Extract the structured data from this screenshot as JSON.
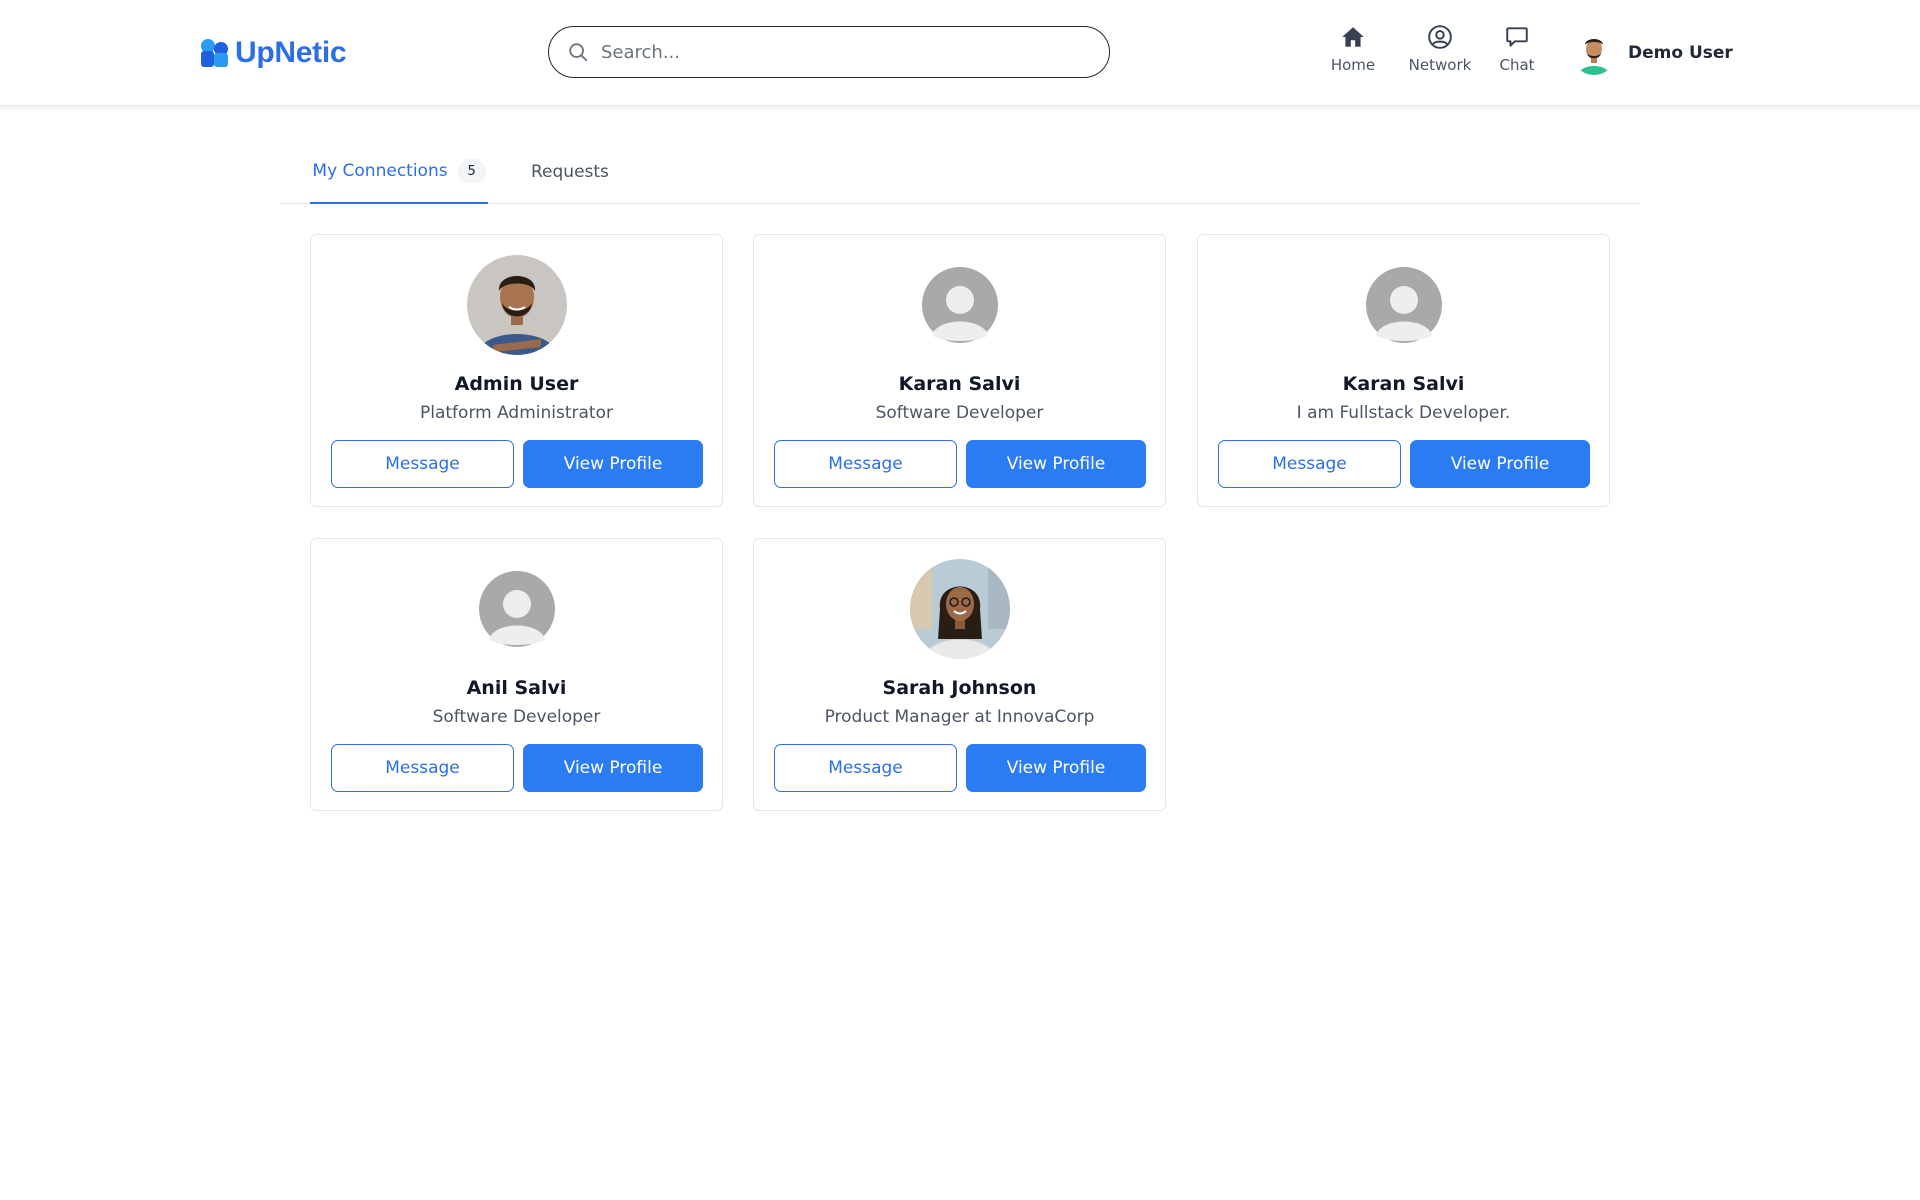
{
  "app": {
    "name": "UpNetic",
    "brand_color": "#2b6fe8",
    "button_color": "#2b7bf3"
  },
  "search": {
    "placeholder": "Search..."
  },
  "nav": {
    "home_label": "Home",
    "network_label": "Network",
    "chat_label": "Chat"
  },
  "user": {
    "name": "Demo User"
  },
  "tabs": {
    "connections_label": "My Connections",
    "connections_count": "5",
    "requests_label": "Requests"
  },
  "connections": [
    {
      "name": "Admin User",
      "title": "Platform Administrator",
      "avatar": "photo-man",
      "message_label": "Message",
      "view_label": "View Profile"
    },
    {
      "name": "Karan Salvi",
      "title": "Software Developer",
      "avatar": "default-avatar-icon",
      "message_label": "Message",
      "view_label": "View Profile"
    },
    {
      "name": "Karan Salvi",
      "title": "I am Fullstack Developer.",
      "avatar": "default-avatar-icon",
      "message_label": "Message",
      "view_label": "View Profile"
    },
    {
      "name": "Anil Salvi",
      "title": "Software Developer",
      "avatar": "default-avatar-icon",
      "message_label": "Message",
      "view_label": "View Profile"
    },
    {
      "name": "Sarah Johnson",
      "title": "Product Manager at InnovaCorp",
      "avatar": "photo-woman",
      "message_label": "Message",
      "view_label": "View Profile"
    }
  ]
}
